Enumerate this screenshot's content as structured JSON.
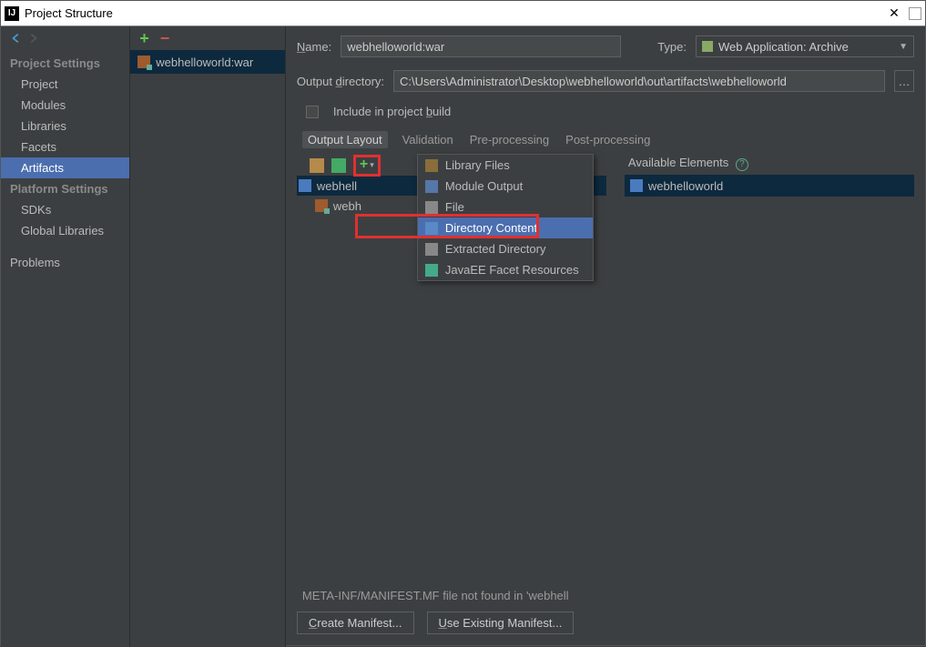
{
  "window": {
    "title": "Project Structure"
  },
  "sidebar": {
    "groups": [
      {
        "heading": "Project Settings",
        "items": [
          {
            "label": "Project",
            "selected": false
          },
          {
            "label": "Modules",
            "selected": false
          },
          {
            "label": "Libraries",
            "selected": false
          },
          {
            "label": "Facets",
            "selected": false
          },
          {
            "label": "Artifacts",
            "selected": true
          }
        ]
      },
      {
        "heading": "Platform Settings",
        "items": [
          {
            "label": "SDKs",
            "selected": false
          },
          {
            "label": "Global Libraries",
            "selected": false
          }
        ]
      },
      {
        "heading": "",
        "items": [
          {
            "label": "Problems",
            "selected": false
          }
        ]
      }
    ]
  },
  "artifact_list": {
    "selected_label": "webhelloworld:war"
  },
  "form": {
    "name_label": "Name:",
    "name_value": "webhelloworld:war",
    "type_label": "Type:",
    "type_value": "Web Application: Archive",
    "output_dir_label": "Output directory:",
    "output_dir_value": "C:\\Users\\Administrator\\Desktop\\webhelloworld\\out\\artifacts\\webhelloworld",
    "include_label": "Include in project build"
  },
  "tabs": {
    "items": [
      {
        "label": "Output Layout",
        "active": true
      },
      {
        "label": "Validation",
        "active": false
      },
      {
        "label": "Pre-processing",
        "active": false
      },
      {
        "label": "Post-processing",
        "active": false
      }
    ]
  },
  "tree": {
    "root_label": "webhell",
    "child_label": "webh"
  },
  "add_popup": {
    "items": [
      {
        "label": "Library Files",
        "icon": "pi-lib",
        "hl": false
      },
      {
        "label": "Module Output",
        "icon": "pi-mod",
        "hl": false
      },
      {
        "label": "File",
        "icon": "pi-file",
        "hl": false
      },
      {
        "label": "Directory Content",
        "icon": "pi-dir",
        "hl": true
      },
      {
        "label": "Extracted Directory",
        "icon": "pi-ext",
        "hl": false
      },
      {
        "label": "JavaEE Facet Resources",
        "icon": "pi-jee",
        "hl": false
      }
    ]
  },
  "available": {
    "heading": "Available Elements",
    "item_label": "webhelloworld"
  },
  "footer": {
    "message": "META-INF/MANIFEST.MF file not found in 'webhell",
    "create_btn": "Create Manifest...",
    "use_btn": "Use Existing Manifest..."
  }
}
